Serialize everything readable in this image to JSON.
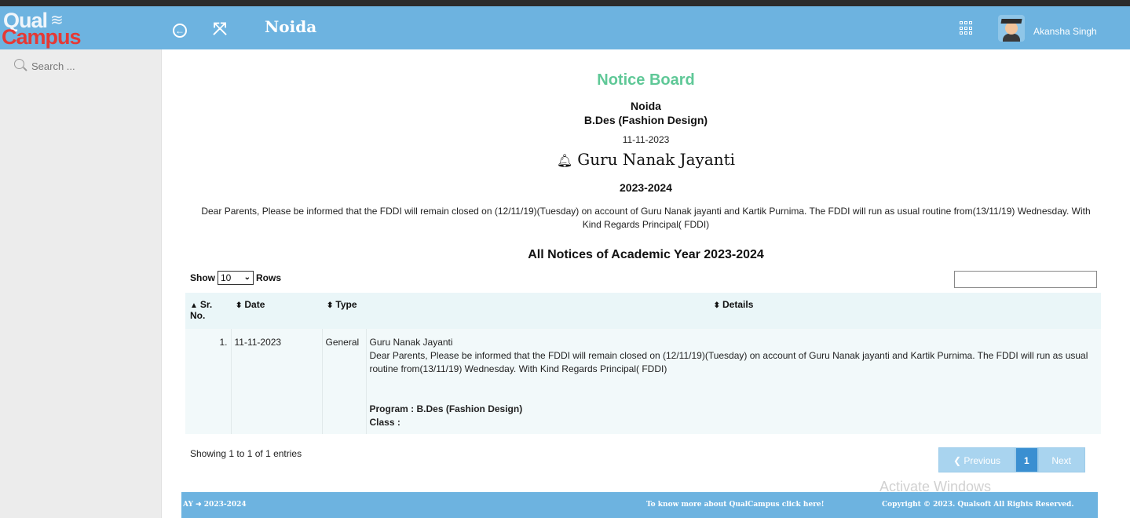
{
  "logo": {
    "text_top": "Qual",
    "text_bottom": "Campus"
  },
  "header": {
    "campus": "Noida",
    "user_name": "Akansha Singh"
  },
  "sidebar": {
    "search_placeholder": "Search ..."
  },
  "notice": {
    "board_title": "Notice Board",
    "campus": "Noida",
    "program": "B.Des (Fashion Design)",
    "date": "11-11-2023",
    "heading": "Guru Nanak Jayanti",
    "academic_year": "2023-2024",
    "body": "Dear Parents, Please be informed that the FDDI will remain closed on (12/11/19)(Tuesday) on account of Guru Nanak jayanti and Kartik Purnima. The FDDI will run as usual routine from(13/11/19) Wednesday. With Kind Regards Principal( FDDI)"
  },
  "list": {
    "title": "All Notices of Academic Year 2023-2024",
    "show_label": "Show",
    "rows_value": "10",
    "rows_label": "Rows",
    "columns": {
      "sr_a": "Sr.",
      "sr_b": "No.",
      "date": "Date",
      "type": "Type",
      "details": "Details"
    },
    "rows": [
      {
        "sr": "1.",
        "date": "11-11-2023",
        "type": "General",
        "title": "Guru Nanak Jayanti",
        "text": "Dear Parents, Please be informed that the FDDI will remain closed on (12/11/19)(Tuesday) on account of Guru Nanak jayanti and Kartik Purnima. The FDDI will run as usual routine from(13/11/19) Wednesday. With Kind Regards Principal( FDDI)",
        "program": "Program : B.Des (Fashion Design)",
        "class": "Class :"
      }
    ],
    "showing": "Showing 1 to 1 of 1 entries",
    "pager": {
      "prev": "Previous",
      "page": "1",
      "next": "Next"
    }
  },
  "watermark": "Activate Windows",
  "footer": {
    "ay_label": "AY",
    "ay_value": "2023-2024",
    "more": "To know more about QualCampus click here!",
    "copyright": "Copyright © 2023. Qualsoft All Rights Reserved."
  },
  "colors": {
    "header": "#6db3e0",
    "title_green": "#5fc897",
    "logo_red": "#e53935"
  },
  "icons": [
    "back-circle-icon",
    "expand-icon",
    "apps-grid-icon",
    "bell-icon",
    "search-icon",
    "sort-icon",
    "arrow-right-icon"
  ]
}
